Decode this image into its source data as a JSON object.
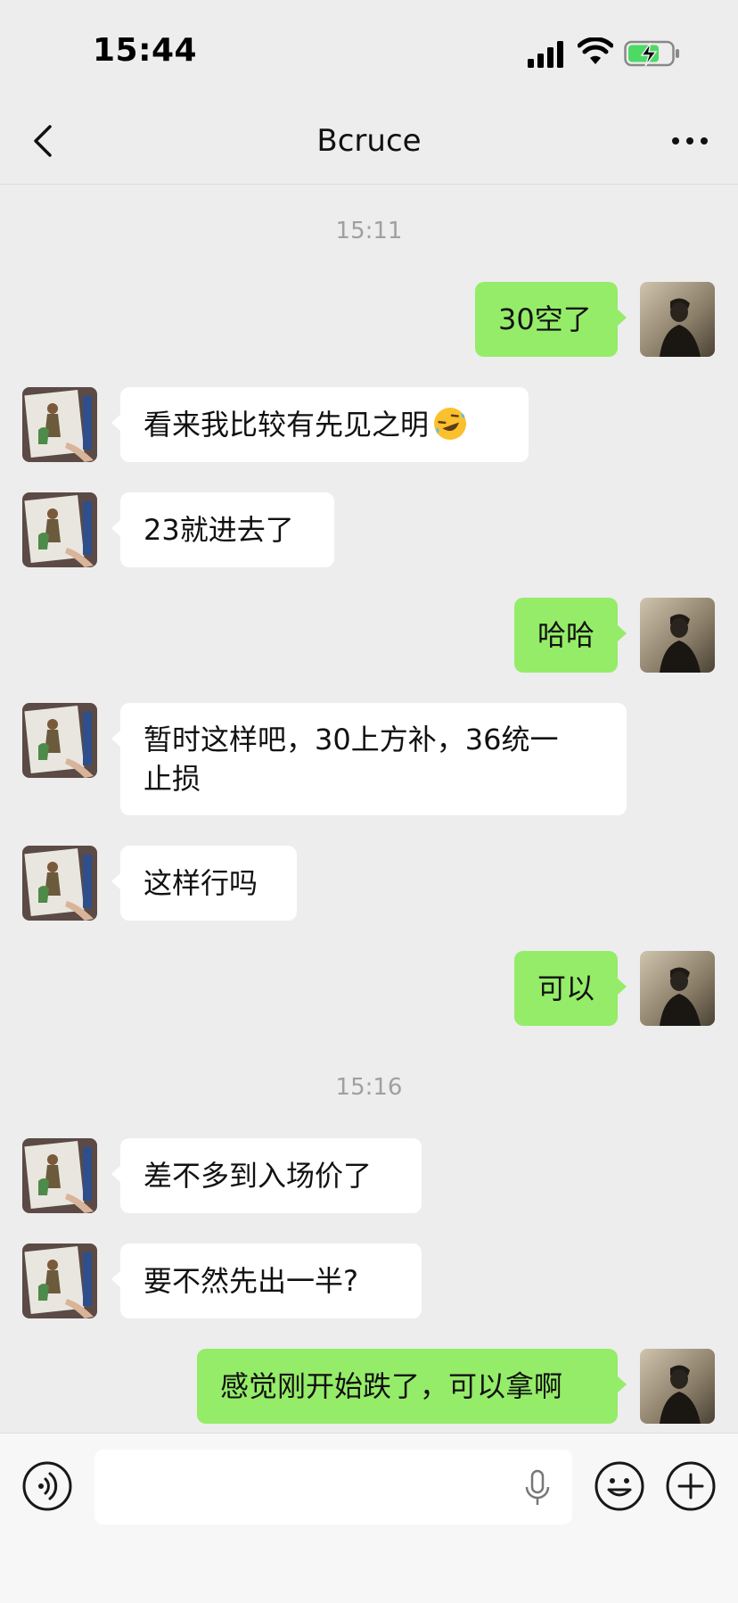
{
  "status_bar": {
    "time": "15:44"
  },
  "nav": {
    "title": "Bcruce"
  },
  "messages": [
    {
      "type": "timestamp",
      "text": "15:11"
    },
    {
      "type": "self",
      "text": "30空了"
    },
    {
      "type": "peer",
      "text": "看来我比较有先见之明",
      "emoji": "rofl-emoji"
    },
    {
      "type": "peer",
      "text": "23就进去了"
    },
    {
      "type": "self",
      "text": "哈哈"
    },
    {
      "type": "peer",
      "text_line1": "暂时这样吧，30上方补，36统一",
      "text_line2": "止损"
    },
    {
      "type": "peer",
      "text": "这样行吗"
    },
    {
      "type": "self",
      "text": "可以"
    },
    {
      "type": "timestamp",
      "text": "15:16"
    },
    {
      "type": "peer",
      "text": "差不多到入场价了"
    },
    {
      "type": "peer",
      "text": "要不然先出一半?"
    },
    {
      "type": "self",
      "text": "感觉刚开始跌了，可以拿啊"
    }
  ],
  "input": {
    "value": "",
    "placeholder": ""
  },
  "colors": {
    "self_bubble": "#95ec69",
    "peer_bubble": "#ffffff",
    "background": "#ededed"
  }
}
